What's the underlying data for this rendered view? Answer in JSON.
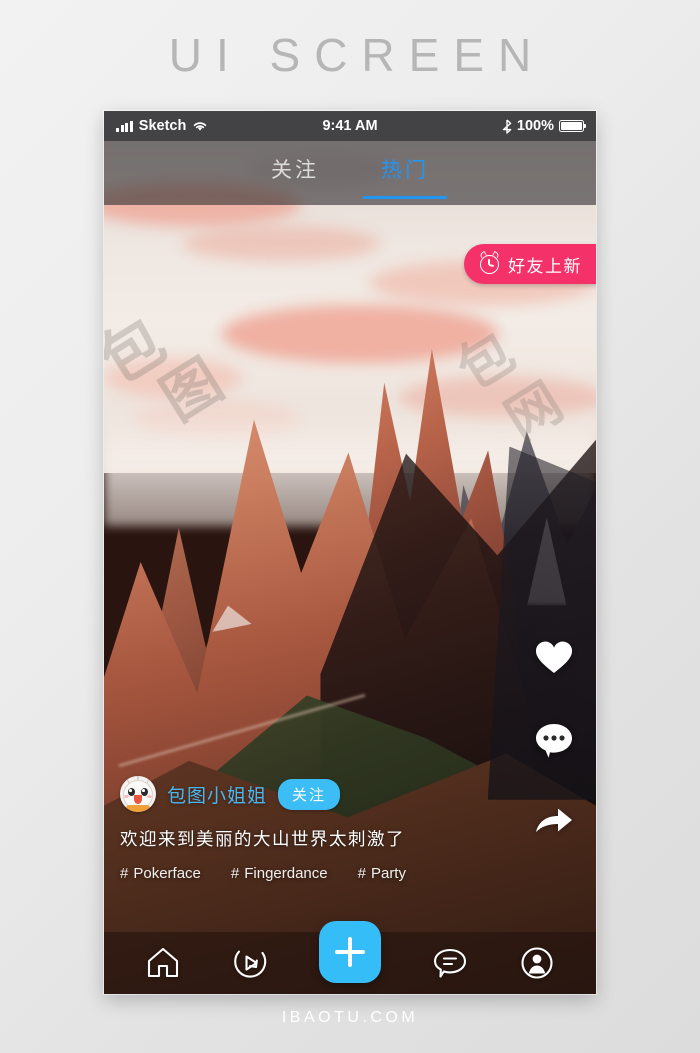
{
  "page": {
    "title": "UI SCREEN",
    "footer": "IBAOTU.COM"
  },
  "colors": {
    "accent_blue": "#2196f3",
    "button_blue": "#3dbdf5",
    "badge_pink": "#f5316a",
    "username_blue": "#4ab6ef"
  },
  "status_bar": {
    "carrier": "Sketch",
    "time": "9:41 AM",
    "battery_percent": "100%",
    "signal_icon": "signal-bars-icon",
    "wifi_icon": "wifi-icon",
    "bluetooth_icon": "bluetooth-icon",
    "battery_icon": "battery-full-icon"
  },
  "tabs": [
    {
      "label": "关注",
      "active": false
    },
    {
      "label": "热门",
      "active": true
    }
  ],
  "friend_badge": {
    "label": "好友上新",
    "icon": "alarm-clock-icon"
  },
  "actions": [
    {
      "name": "like",
      "icon": "heart-icon"
    },
    {
      "name": "comment",
      "icon": "comment-bubble-icon"
    },
    {
      "name": "share",
      "icon": "share-arrow-icon"
    }
  ],
  "post": {
    "avatar_icon": "rabbit-avatar-icon",
    "username": "包图小姐姐",
    "follow_label": "关注",
    "caption": "欢迎来到美丽的大山世界太刺激了",
    "hashtag_symbol": "#",
    "hashtags": [
      "Pokerface",
      "Fingerdance",
      "Party"
    ]
  },
  "navbar": [
    {
      "name": "home",
      "icon": "home-icon"
    },
    {
      "name": "discover",
      "icon": "discover-play-icon"
    },
    {
      "name": "create",
      "icon": "plus-icon"
    },
    {
      "name": "messages",
      "icon": "message-bubble-icon"
    },
    {
      "name": "profile",
      "icon": "person-icon"
    }
  ],
  "watermark": {
    "mark_a": "包",
    "mark_b": "图",
    "mark_c": "包",
    "mark_d": "网"
  }
}
